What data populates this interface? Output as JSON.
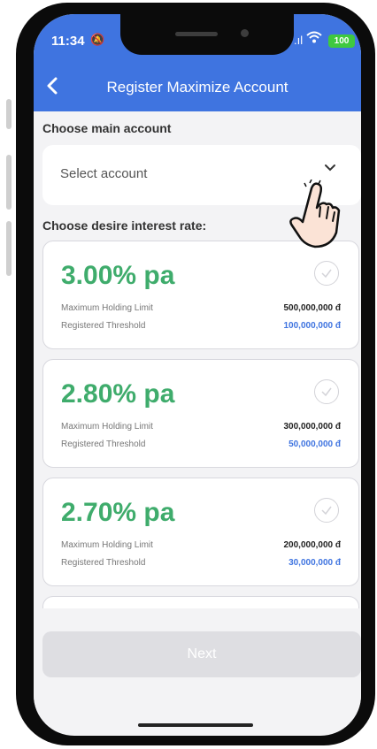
{
  "status_bar": {
    "time": "11:34",
    "battery": "100"
  },
  "header": {
    "back_icon": "chevron-left-icon",
    "title": "Register Maximize Account"
  },
  "account_section": {
    "label": "Choose main account",
    "select_placeholder": "Select account",
    "dropdown_icon": "chevron-down-icon"
  },
  "rate_section": {
    "label": "Choose desire interest rate:",
    "options": [
      {
        "rate": "3.00% pa",
        "limit_label": "Maximum Holding Limit",
        "limit_value": "500,000,000 đ",
        "threshold_label": "Registered Threshold",
        "threshold_value": "100,000,000 đ"
      },
      {
        "rate": "2.80% pa",
        "limit_label": "Maximum Holding Limit",
        "limit_value": "300,000,000 đ",
        "threshold_label": "Registered Threshold",
        "threshold_value": "50,000,000 đ"
      },
      {
        "rate": "2.70% pa",
        "limit_label": "Maximum Holding Limit",
        "limit_value": "200,000,000 đ",
        "threshold_label": "Registered Threshold",
        "threshold_value": "30,000,000 đ"
      }
    ]
  },
  "next_button": {
    "label": "Next"
  },
  "colors": {
    "header_blue": "#3f74e0",
    "rate_green": "#3fac6c",
    "battery_green": "#3fc93f"
  }
}
